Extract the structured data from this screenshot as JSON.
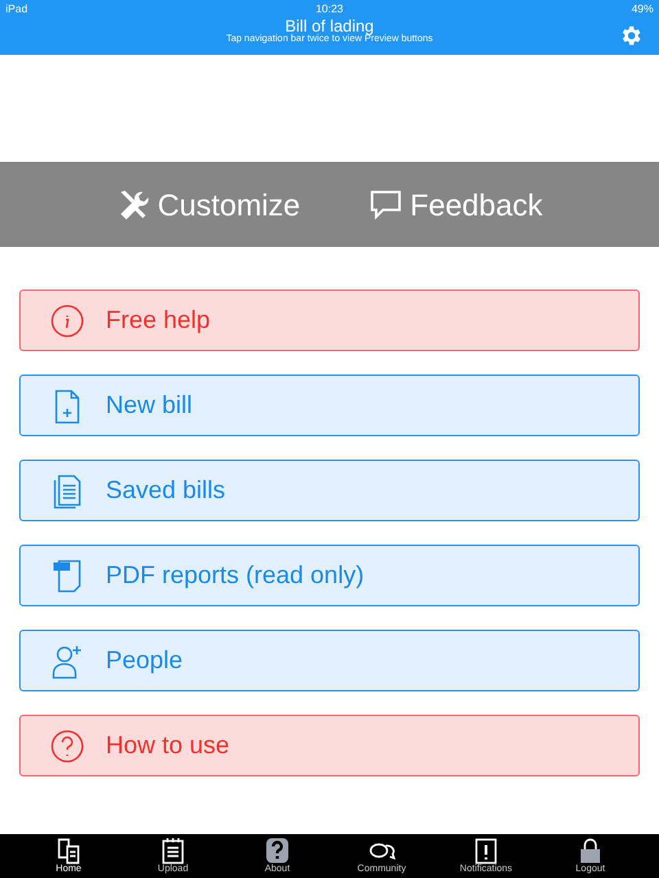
{
  "status_bar": {
    "device": "iPad",
    "time": "10:23",
    "battery": "49%"
  },
  "nav_bar": {
    "title": "Bill of lading",
    "subtitle": "Tap navigation bar twice to view Preview buttons"
  },
  "toolbar": [
    "Customize",
    "Feedback"
  ],
  "menu": [
    {
      "label": "Free help",
      "kind": "alert"
    },
    {
      "label": "New bill",
      "kind": "standard"
    },
    {
      "label": "Saved bills",
      "kind": "standard"
    },
    {
      "label": "PDF reports (read only)",
      "kind": "standard"
    },
    {
      "label": "People",
      "kind": "standard"
    },
    {
      "label": "How to use",
      "kind": "alert"
    }
  ],
  "tab_bar": [
    {
      "label": "Home",
      "selected": true
    },
    {
      "label": "Upload",
      "selected": false
    },
    {
      "label": "About",
      "selected": false
    },
    {
      "label": "Community",
      "selected": false
    },
    {
      "label": "Notifications",
      "selected": false
    },
    {
      "label": "Logout",
      "selected": false
    }
  ]
}
